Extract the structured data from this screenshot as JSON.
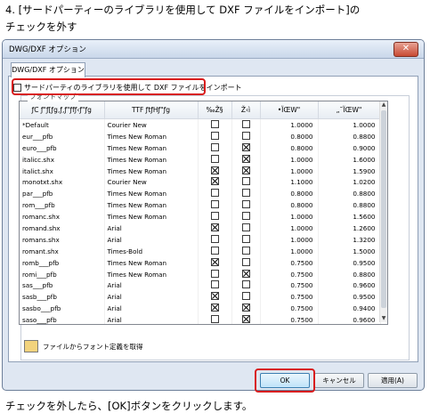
{
  "instructions": {
    "step_line1": "4. [サードパーティーのライブラリを使用して DXF ファイルをインポート]の",
    "step_line2": "チェックを外す",
    "after_line": "チェックを外したら、[OK]ボタンをクリックします。"
  },
  "dialog": {
    "title": "DWG/DXF オプション",
    "close_glyph": "✕",
    "tab_label": "DWG/DXF オプション",
    "third_party_label": "サードパーティのライブラリを使用して DXF ファイルをインポート",
    "third_party_checked": false,
    "group_label": "フォントマップ",
    "table": {
      "headers": [
        "ƒC ƒ\"ƒ[ƒg,ƒ,ƒ\"ƒfƒ‹ƒ\"ƒg",
        "TTF ƒtƒHƒ\"ƒg",
        "‰Ž§",
        "Ž‹ì",
        "•ÏŒW\"",
        "„˜ÏŒW\""
      ],
      "rows": [
        {
          "font": "*Default",
          "ttf": "Courier New",
          "c1": false,
          "c2": false,
          "v1": "1.0000",
          "v2": "1.0000"
        },
        {
          "font": "eur___pfb",
          "ttf": "Times New Roman",
          "c1": false,
          "c2": false,
          "v1": "0.8000",
          "v2": "0.8800"
        },
        {
          "font": "euro___pfb",
          "ttf": "Times New Roman",
          "c1": false,
          "c2": true,
          "v1": "0.8000",
          "v2": "0.9000"
        },
        {
          "font": "italicc.shx",
          "ttf": "Times New Roman",
          "c1": false,
          "c2": true,
          "v1": "1.0000",
          "v2": "1.6000"
        },
        {
          "font": "italict.shx",
          "ttf": "Times New Roman",
          "c1": true,
          "c2": true,
          "v1": "1.0000",
          "v2": "1.5900"
        },
        {
          "font": "monotxt.shx",
          "ttf": "Courier New",
          "c1": true,
          "c2": false,
          "v1": "1.1000",
          "v2": "1.0200"
        },
        {
          "font": "par___pfb",
          "ttf": "Times New Roman",
          "c1": false,
          "c2": false,
          "v1": "0.8000",
          "v2": "0.8800"
        },
        {
          "font": "rom___pfb",
          "ttf": "Times New Roman",
          "c1": false,
          "c2": false,
          "v1": "0.8000",
          "v2": "0.8800"
        },
        {
          "font": "romanc.shx",
          "ttf": "Times New Roman",
          "c1": false,
          "c2": false,
          "v1": "1.0000",
          "v2": "1.5600"
        },
        {
          "font": "romand.shx",
          "ttf": "Arial",
          "c1": true,
          "c2": false,
          "v1": "1.0000",
          "v2": "1.2600"
        },
        {
          "font": "romans.shx",
          "ttf": "Arial",
          "c1": false,
          "c2": false,
          "v1": "1.0000",
          "v2": "1.3200"
        },
        {
          "font": "romant.shx",
          "ttf": "Times-Bold",
          "c1": false,
          "c2": false,
          "v1": "1.0000",
          "v2": "1.5000"
        },
        {
          "font": "romb___pfb",
          "ttf": "Times New Roman",
          "c1": true,
          "c2": false,
          "v1": "0.7500",
          "v2": "0.9500"
        },
        {
          "font": "romi___pfb",
          "ttf": "Times New Roman",
          "c1": false,
          "c2": true,
          "v1": "0.7500",
          "v2": "0.8800"
        },
        {
          "font": "sas___pfb",
          "ttf": "Arial",
          "c1": false,
          "c2": false,
          "v1": "0.7500",
          "v2": "0.9600"
        },
        {
          "font": "sasb___pfb",
          "ttf": "Arial",
          "c1": true,
          "c2": false,
          "v1": "0.7500",
          "v2": "0.9500"
        },
        {
          "font": "sasbo___pfb",
          "ttf": "Arial",
          "c1": true,
          "c2": true,
          "v1": "0.7500",
          "v2": "0.9400"
        },
        {
          "font": "saso___pfb",
          "ttf": "Arial",
          "c1": false,
          "c2": true,
          "v1": "0.7500",
          "v2": "0.9600"
        }
      ]
    },
    "load_font_label": "ファイルからフォント定義を取得",
    "buttons": {
      "ok": "OK",
      "cancel": "キャンセル",
      "apply": "適用(A)"
    }
  }
}
